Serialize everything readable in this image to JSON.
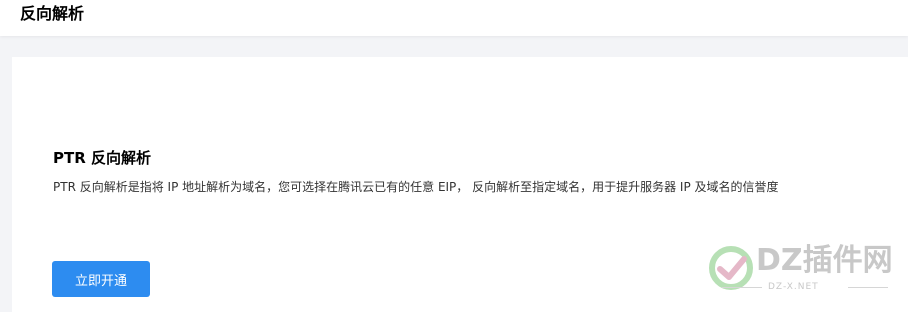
{
  "header": {
    "title": "反向解析"
  },
  "ptr_section": {
    "title": "PTR 反向解析",
    "description": "PTR 反向解析是指将 IP 地址解析为域名，您可选择在腾讯云已有的任意 EIP， 反向解析至指定域名，用于提升服务器 IP 及域名的信誉度",
    "enable_button": "立即开通"
  },
  "watermark": {
    "text": "DZ插件网",
    "subtext": "DZ-X.NET"
  },
  "colors": {
    "primary": "#2d8cf0",
    "background": "#f3f4f7",
    "card": "#ffffff"
  }
}
